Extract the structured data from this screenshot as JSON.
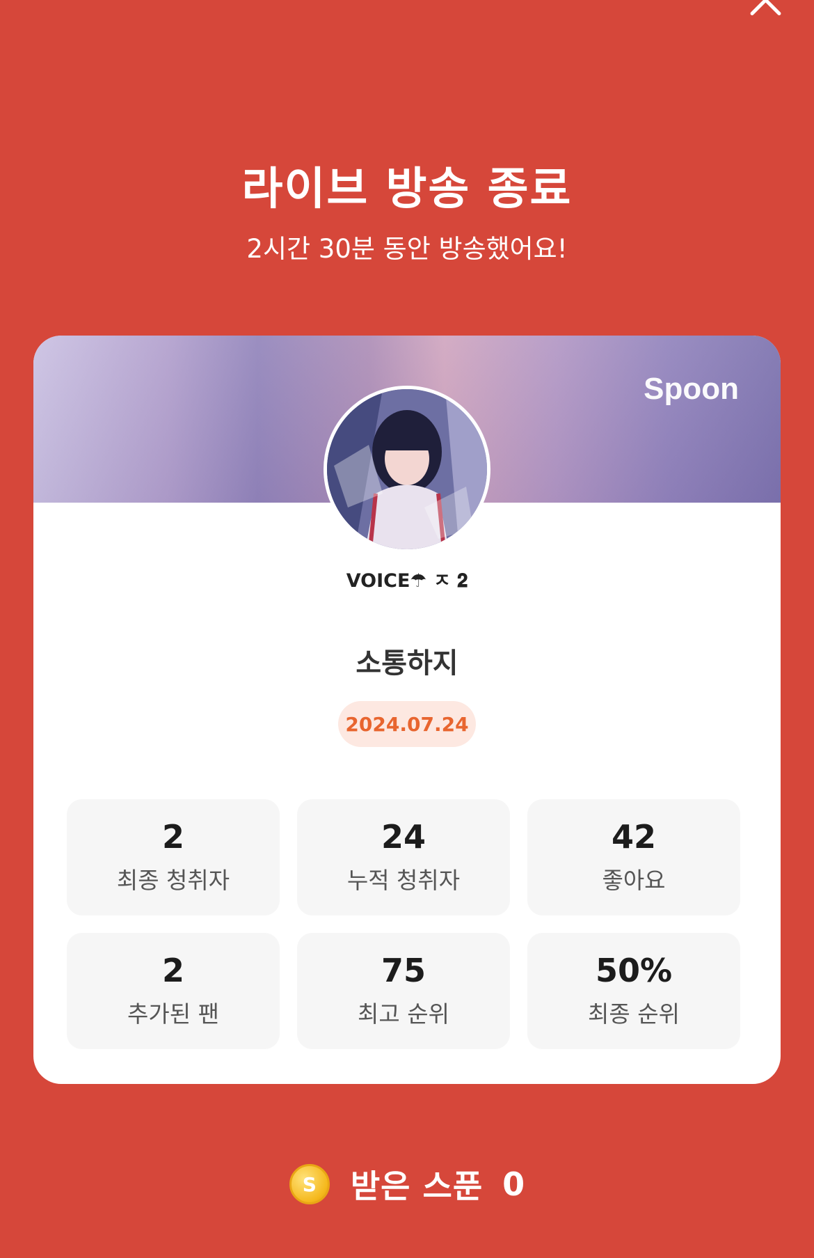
{
  "header": {
    "title": "라이브 방송 종료",
    "subtitle": "2시간 30분 동안 방송했어요!"
  },
  "card": {
    "brand": "Spoon",
    "nickname": "VOICE☂︎ ㅈ 𝟐",
    "live_title": "소통하지",
    "date": "2024.07.24",
    "stats": [
      {
        "value": "2",
        "label": "최종 청취자"
      },
      {
        "value": "24",
        "label": "누적 청취자"
      },
      {
        "value": "42",
        "label": "좋아요"
      },
      {
        "value": "2",
        "label": "추가된 팬"
      },
      {
        "value": "75",
        "label": "최고 순위"
      },
      {
        "value": "50%",
        "label": "최종 순위"
      }
    ]
  },
  "footer": {
    "coin_symbol": "S",
    "label": "받은 스푼",
    "value": "0"
  },
  "colors": {
    "background": "#d6473a",
    "date_badge_text": "#e8652f",
    "date_badge_bg": "#fde8e1",
    "coin": "#f5b81c"
  },
  "icons": {
    "close": "close-icon",
    "coin": "spoon-coin-icon"
  }
}
